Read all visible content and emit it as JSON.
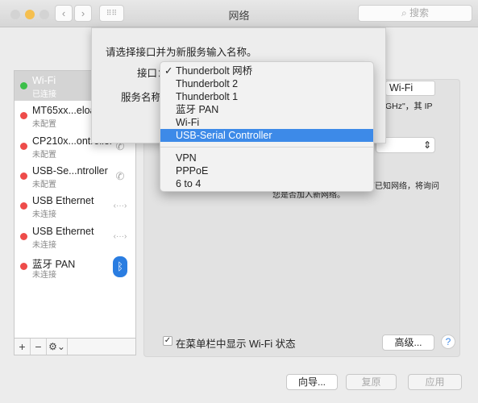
{
  "window": {
    "title": "网络",
    "search_placeholder": "搜索",
    "colors": {
      "close": "#d3d3d3",
      "minimize": "#f5bf4f",
      "zoom": "#d3d3d3",
      "accent": "#3d8ae8"
    }
  },
  "sidebar": {
    "items": [
      {
        "name": "Wi-Fi",
        "status": "已连接",
        "dot": "#3cbf49",
        "icon": "wifi-icon",
        "selected": true
      },
      {
        "name": "MT65xx...eloa",
        "status": "未配置",
        "dot": "#ee4c4a",
        "icon": "phone-icon"
      },
      {
        "name": "CP210x...ontroller",
        "status": "未配置",
        "dot": "#ee4c4a",
        "icon": "phone-icon"
      },
      {
        "name": "USB-Se...ntroller",
        "status": "未配置",
        "dot": "#ee4c4a",
        "icon": "phone-icon"
      },
      {
        "name": "USB Ethernet",
        "status": "未连接",
        "dot": "#ee4c4a",
        "icon": "ethernet-icon"
      },
      {
        "name": "USB Ethernet",
        "status": "未连接",
        "dot": "#ee4c4a",
        "icon": "ethernet-icon"
      },
      {
        "name": "蓝牙 PAN",
        "status": "未连接",
        "dot": "#ee4c4a",
        "icon": "bluetooth-icon"
      }
    ],
    "add": "+",
    "remove": "−",
    "gear": "⚙⌄"
  },
  "panel": {
    "network_name": "Wi-Fi",
    "desc_fragment": "GHz\"，其 IP",
    "desc2_a": "有已知网络，将询问",
    "desc2_b": "您是否加入新网络。",
    "show_wifi_status": "在菜单栏中显示 Wi-Fi 状态",
    "show_wifi_checked": true,
    "advanced": "高级...",
    "help": "?"
  },
  "footer": {
    "assist": "向导...",
    "revert": "复原",
    "apply": "应用"
  },
  "sheet": {
    "prompt": "请选择接口并为新服务输入名称。",
    "interface_label": "接口：",
    "service_label": "服务名称："
  },
  "menu": {
    "checked": "Thunderbolt 网桥",
    "highlighted": "USB-Serial Controller",
    "group1": [
      "Thunderbolt 网桥",
      "Thunderbolt 2",
      "Thunderbolt 1",
      "蓝牙 PAN",
      "Wi-Fi",
      "USB-Serial Controller"
    ],
    "group2": [
      "VPN",
      "PPPoE",
      "6 to 4"
    ]
  }
}
